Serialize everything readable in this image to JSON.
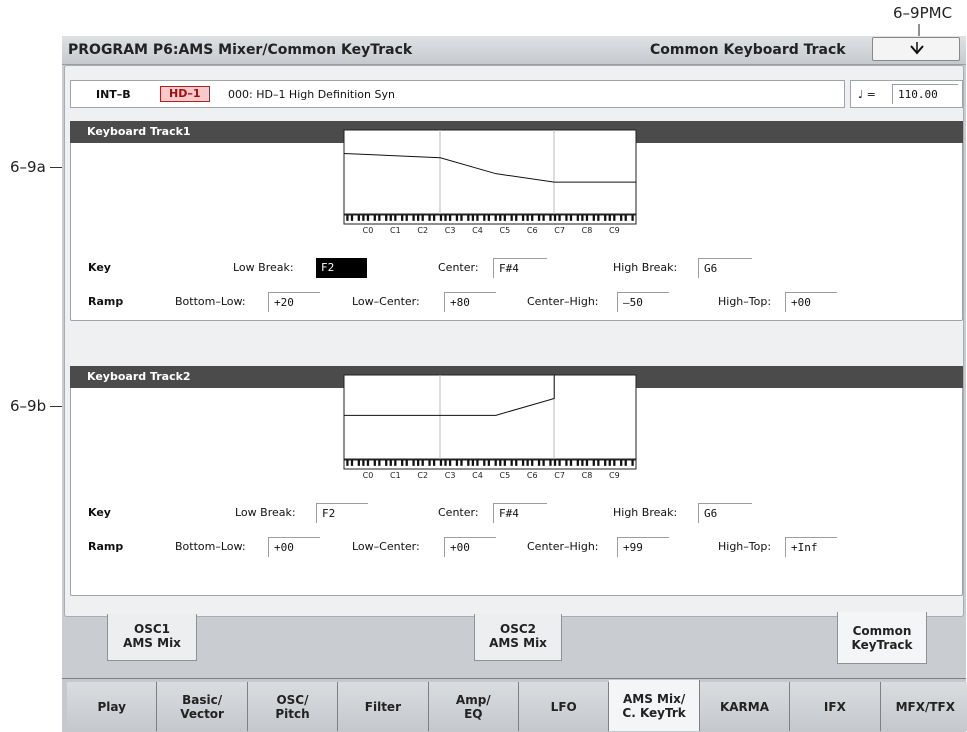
{
  "callouts": {
    "top": "6–9PMC",
    "a": "6–9a",
    "b": "6–9b"
  },
  "title": "PROGRAM P6:AMS Mixer/Common KeyTrack",
  "page_name": "Common Keyboard Track",
  "program": {
    "bank": "INT–B",
    "type_badge": "HD–1",
    "name": "000: HD–1 High Definition Syn"
  },
  "tempo": {
    "symbol": "♩ =",
    "value": "110.00"
  },
  "track1": {
    "header": "Keyboard Track1",
    "key_label": "Key",
    "ramp_label": "Ramp",
    "low_break_label": "Low Break:",
    "low_break": "F2",
    "center_label": "Center:",
    "center": "F#4",
    "high_break_label": "High Break:",
    "high_break": "G6",
    "bottom_low_label": "Bottom–Low:",
    "bottom_low": "+20",
    "low_center_label": "Low–Center:",
    "low_center": "+80",
    "center_high_label": "Center–High:",
    "center_high": "–50",
    "high_top_label": "High–Top:",
    "high_top": "+00"
  },
  "track2": {
    "header": "Keyboard Track2",
    "key_label": "Key",
    "ramp_label": "Ramp",
    "low_break_label": "Low Break:",
    "low_break": "F2",
    "center_label": "Center:",
    "center": "F#4",
    "high_break_label": "High Break:",
    "high_break": "G6",
    "bottom_low_label": "Bottom–Low:",
    "bottom_low": "+00",
    "low_center_label": "Low–Center:",
    "low_center": "+00",
    "center_high_label": "Center–High:",
    "center_high": "+99",
    "high_top_label": "High–Top:",
    "high_top": "+Inf"
  },
  "octave_labels": [
    "C0",
    "C1",
    "C2",
    "C3",
    "C4",
    "C5",
    "C6",
    "C7",
    "C8",
    "C9"
  ],
  "sub_tabs": [
    {
      "line1": "OSC1",
      "line2": "AMS Mix"
    },
    {
      "line1": "OSC2",
      "line2": "AMS Mix"
    },
    {
      "line1": "Common",
      "line2": "KeyTrack"
    }
  ],
  "bottom_tabs": [
    {
      "line1": "Play",
      "line2": ""
    },
    {
      "line1": "Basic/",
      "line2": "Vector"
    },
    {
      "line1": "OSC/",
      "line2": "Pitch"
    },
    {
      "line1": "Filter",
      "line2": ""
    },
    {
      "line1": "Amp/",
      "line2": "EQ"
    },
    {
      "line1": "LFO",
      "line2": ""
    },
    {
      "line1": "AMS Mix/",
      "line2": "C. KeyTrk"
    },
    {
      "line1": "KARMA",
      "line2": ""
    },
    {
      "line1": "IFX",
      "line2": ""
    },
    {
      "line1": "MFX/TFX",
      "line2": ""
    }
  ],
  "icons": {
    "menu": "chevron-down-icon"
  }
}
